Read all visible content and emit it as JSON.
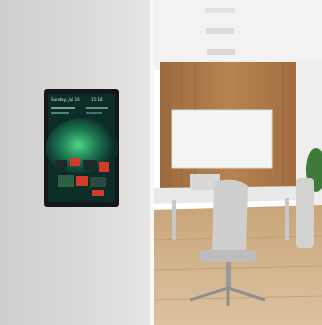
{
  "scene": {
    "kind": "photo",
    "subject": "wall-mounted control tablet beside glass-walled meeting room"
  },
  "tablet": {
    "status_date": "Sunday, Jul 16",
    "status_time": "15:18",
    "colors": {
      "bezel": "#15181a",
      "screen_bg": "#0c2c28",
      "aurora_green": "#39d27a",
      "tile_red": "#d23a2a",
      "tile_dark": "#1b2a2a"
    }
  },
  "room": {
    "colors": {
      "wall_left": "#d6d5d3",
      "wood": "#b07a48",
      "floor": "#cfb08a",
      "ceiling": "#f3f3f1"
    }
  }
}
